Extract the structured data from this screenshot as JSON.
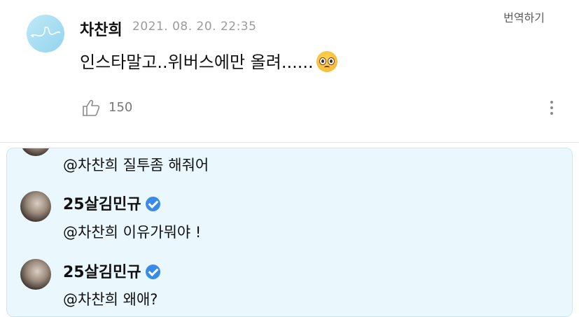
{
  "post": {
    "author": "차찬희",
    "timestamp": "2021. 08. 20. 22:35",
    "translate_label": "번역하기",
    "body_text": "인스타말고..위버스에만 올려......",
    "emoji_icon": "pleading-face-emoji",
    "like_count": "150"
  },
  "replies": [
    {
      "author": "",
      "verified": false,
      "text": "@차찬희 질투좀 해줘어"
    },
    {
      "author": "25살김민규",
      "verified": true,
      "text": "@차찬희 이유가뭐야 !"
    },
    {
      "author": "25살김민규",
      "verified": true,
      "text": "@차찬희 왜애?"
    }
  ],
  "colors": {
    "reply_background": "#eaf7fd",
    "verified_badge": "#3a8be8",
    "timestamp": "#9b9b9b"
  }
}
